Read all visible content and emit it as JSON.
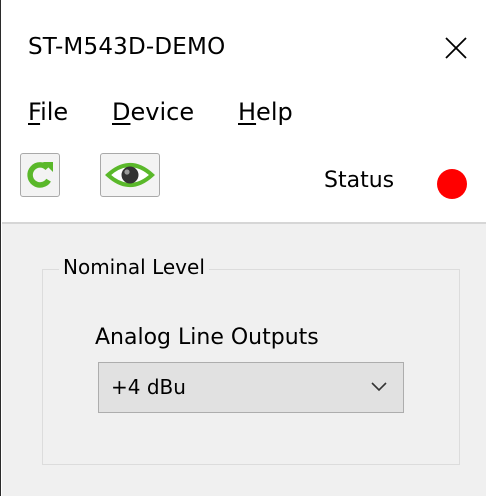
{
  "window": {
    "title": "ST-M543D-DEMO",
    "close_glyph": "✕"
  },
  "menu": {
    "items": [
      {
        "accel": "F",
        "rest": "ile"
      },
      {
        "accel": "D",
        "rest": "evice"
      },
      {
        "accel": "H",
        "rest": "elp"
      }
    ]
  },
  "toolbar": {
    "refresh_icon": "refresh-icon",
    "view_icon": "eye-icon",
    "status_label": "Status",
    "status_color": "#ff0000"
  },
  "nominal_level": {
    "group_title": "Nominal Level",
    "field_label": "Analog Line Outputs",
    "selected": "+4 dBu"
  },
  "colors": {
    "icon_green": "#5ab82a",
    "panel_bg": "#f0f0f0"
  }
}
